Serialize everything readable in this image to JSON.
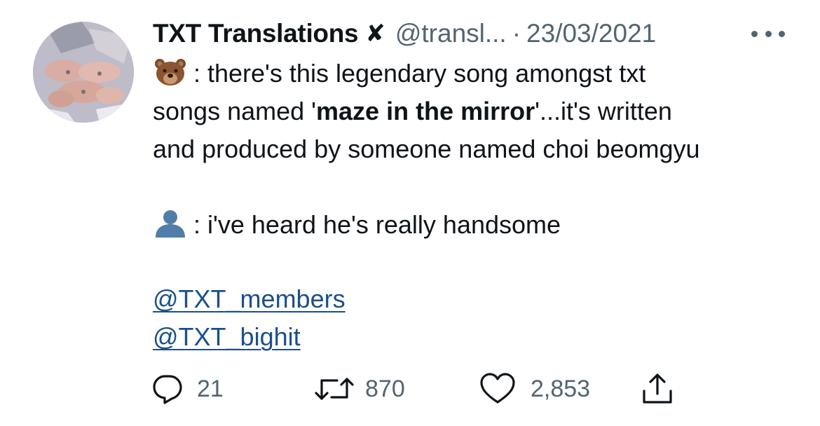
{
  "tweet": {
    "author": {
      "display_name": "TXT Translations",
      "verified_mark": "✘",
      "handle": "@transl...",
      "separator": "·",
      "date": "23/03/2021"
    },
    "more_icon": "more-horizontal-icon",
    "body": {
      "line1_prefix": ": there's this legendary song amongst txt",
      "line2_before": "songs named '",
      "line2_bold": "maze in the mirror",
      "line2_after": "'...it's written",
      "line3": "and produced by someone named choi beomgyu",
      "line4": ": i've heard he's really handsome",
      "mentions": [
        "@TXT_members",
        "@TXT_bighit"
      ]
    },
    "emojis": {
      "first": "bear-face-emoji",
      "second": "bust-silhouette-emoji"
    },
    "stats": {
      "replies": "21",
      "retweets": "870",
      "likes": "2,853"
    },
    "icons": {
      "reply": "reply-icon",
      "retweet": "retweet-icon",
      "like": "heart-icon",
      "share": "share-icon"
    },
    "colors": {
      "text": "#0f1419",
      "secondary": "#536471",
      "link": "#1b4f8a"
    }
  }
}
